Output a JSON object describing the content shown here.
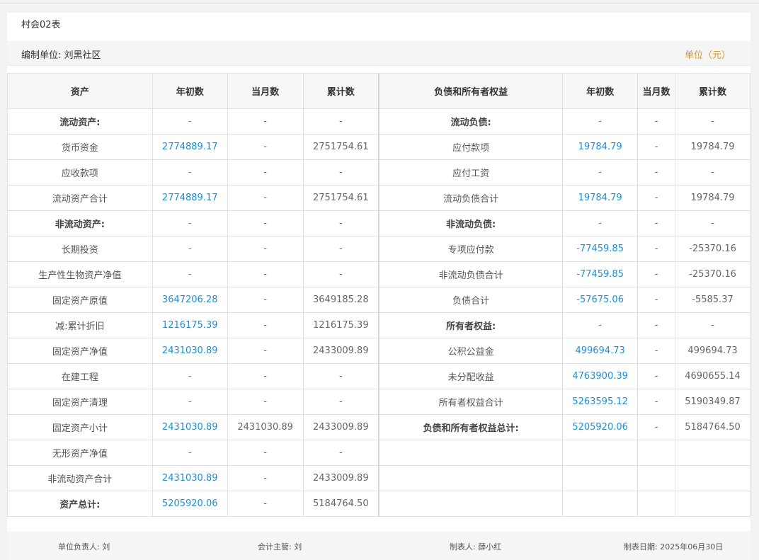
{
  "report_title": "村会02表",
  "org_label": "编制单位: 刘黑社区",
  "unit_label": "单位（元）",
  "headers": {
    "assets": "资产",
    "begin": "年初数",
    "month": "当月数",
    "cumulative": "累计数",
    "liab": "负债和所有者权益",
    "begin2": "年初数",
    "month2": "当月数",
    "cumulative2": "累计数"
  },
  "rows": [
    {
      "a": "流动资产:",
      "ab": "-",
      "am": "-",
      "ac": "-",
      "l": "流动负债:",
      "lb": "-",
      "lm": "-",
      "lc": "-"
    },
    {
      "a": "货币资金",
      "ab": "2774889.17",
      "am": "-",
      "ac": "2751754.61",
      "l": "应付款项",
      "lb": "19784.79",
      "lm": "-",
      "lc": "19784.79"
    },
    {
      "a": "应收款项",
      "ab": "-",
      "am": "-",
      "ac": "-",
      "l": "应付工资",
      "lb": "-",
      "lm": "-",
      "lc": "-"
    },
    {
      "a": "流动资产合计",
      "ab": "2774889.17",
      "am": "-",
      "ac": "2751754.61",
      "l": "流动负债合计",
      "lb": "19784.79",
      "lm": "-",
      "lc": "19784.79"
    },
    {
      "a": "非流动资产:",
      "ab": "-",
      "am": "-",
      "ac": "-",
      "l": "非流动负债:",
      "lb": "-",
      "lm": "-",
      "lc": "-"
    },
    {
      "a": "长期投资",
      "ab": "-",
      "am": "-",
      "ac": "-",
      "l": "专项应付款",
      "lb": "-77459.85",
      "lm": "-",
      "lc": "-25370.16"
    },
    {
      "a": "生产性生物资产净值",
      "ab": "-",
      "am": "-",
      "ac": "-",
      "l": "非流动负债合计",
      "lb": "-77459.85",
      "lm": "-",
      "lc": "-25370.16"
    },
    {
      "a": "固定资产原值",
      "ab": "3647206.28",
      "am": "-",
      "ac": "3649185.28",
      "l": "负债合计",
      "lb": "-57675.06",
      "lm": "-",
      "lc": "-5585.37"
    },
    {
      "a": "减:累计折旧",
      "ab": "1216175.39",
      "am": "-",
      "ac": "1216175.39",
      "l": "所有者权益:",
      "lb": "-",
      "lm": "-",
      "lc": "-"
    },
    {
      "a": "固定资产净值",
      "ab": "2431030.89",
      "am": "-",
      "ac": "2433009.89",
      "l": "公积公益金",
      "lb": "499694.73",
      "lm": "-",
      "lc": "499694.73"
    },
    {
      "a": "在建工程",
      "ab": "-",
      "am": "-",
      "ac": "-",
      "l": "未分配收益",
      "lb": "4763900.39",
      "lm": "-",
      "lc": "4690655.14"
    },
    {
      "a": "固定资产清理",
      "ab": "-",
      "am": "-",
      "ac": "-",
      "l": "所有者权益合计",
      "lb": "5263595.12",
      "lm": "-",
      "lc": "5190349.87"
    },
    {
      "a": "固定资产小计",
      "ab": "2431030.89",
      "am": "2431030.89",
      "ac": "2433009.89",
      "l": "负债和所有者权益总计:",
      "lb": "5205920.06",
      "lm": "-",
      "lc": "5184764.50"
    },
    {
      "a": "无形资产净值",
      "ab": "-",
      "am": "-",
      "ac": "-",
      "l": "",
      "lb": "",
      "lm": "",
      "lc": ""
    },
    {
      "a": "非流动资产合计",
      "ab": "2431030.89",
      "am": "-",
      "ac": "2433009.89",
      "l": "",
      "lb": "",
      "lm": "",
      "lc": ""
    },
    {
      "a": "资产总计:",
      "ab": "5205920.06",
      "am": "-",
      "ac": "5184764.50",
      "l": "",
      "lb": "",
      "lm": "",
      "lc": ""
    }
  ],
  "footer": {
    "head": "单位负责人: 刘",
    "accountant": "会计主管: 刘",
    "preparer": "制表人: 薛小红",
    "date": "制表日期: 2025年06月30日"
  }
}
